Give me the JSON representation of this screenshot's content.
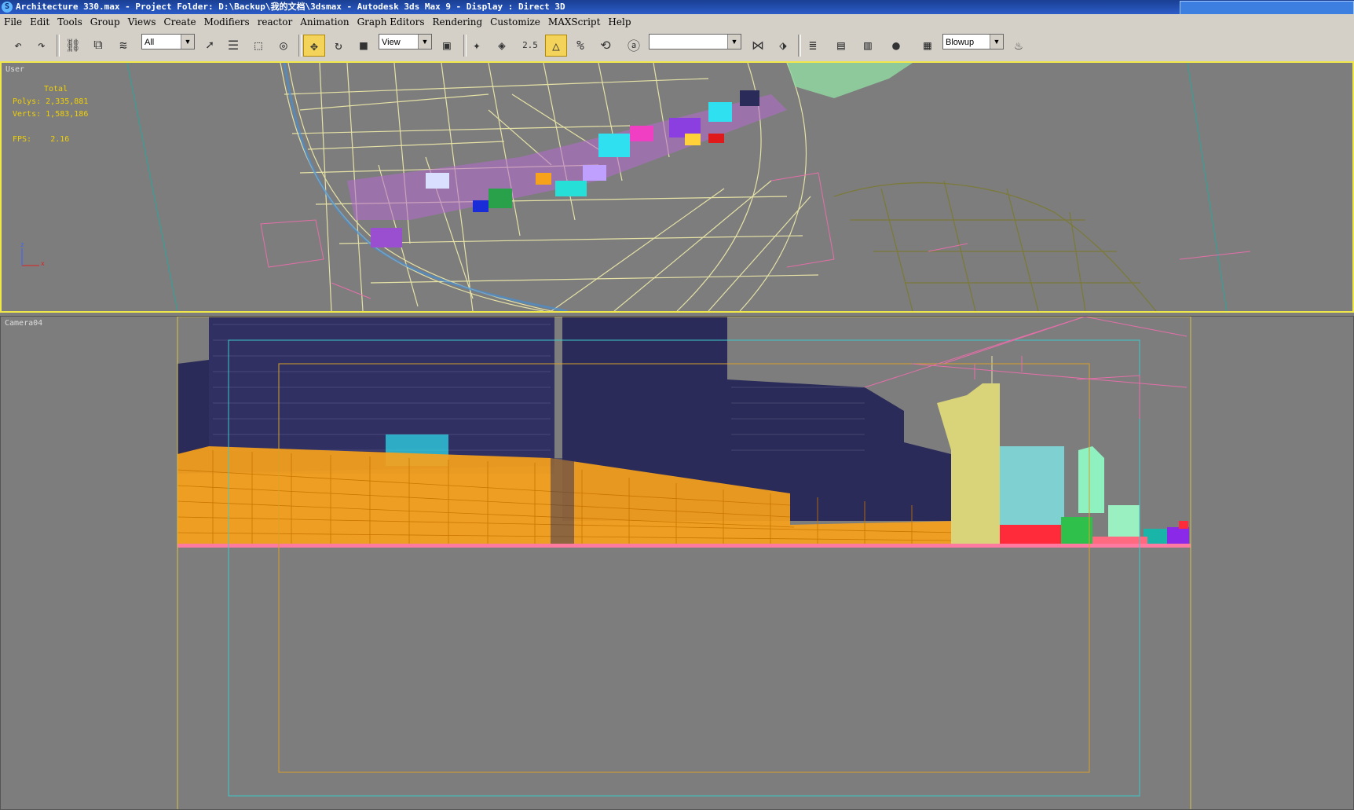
{
  "window": {
    "title": "Architecture 330.max    - Project Folder: D:\\Backup\\我的文档\\3dsmax    - Autodesk 3ds Max 9    - Display : Direct 3D"
  },
  "menu": [
    "File",
    "Edit",
    "Tools",
    "Group",
    "Views",
    "Create",
    "Modifiers",
    "reactor",
    "Animation",
    "Graph Editors",
    "Rendering",
    "Customize",
    "MAXScript",
    "Help"
  ],
  "toolbar": {
    "selection_filter": "All",
    "reference_coord": "View",
    "named_selection": "",
    "render_type": "Blowup",
    "snap_label": "2.5"
  },
  "viewport_top": {
    "label": "User",
    "stats_header": "Total",
    "polys_label": "Polys:",
    "polys_value": "2,335,881",
    "verts_label": "Verts:",
    "verts_value": "1,583,186",
    "fps_label": "FPS:",
    "fps_value": "2.16",
    "axis_z": "z",
    "axis_x": "x"
  },
  "viewport_bottom": {
    "label": "Camera04"
  },
  "colors": {
    "viewport_bg": "#7d7d7d",
    "active_border": "#f0e84a",
    "stats_text": "#f0d000",
    "building_navy": "#2b2b59",
    "wire_orange": "#f7a21b",
    "road_lines": "#e8e4a8"
  }
}
